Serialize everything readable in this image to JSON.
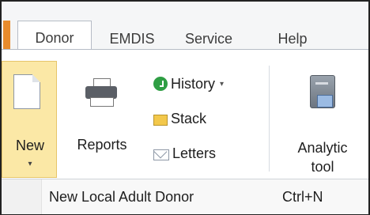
{
  "tabs": [
    {
      "label": "Donor",
      "active": true
    },
    {
      "label": "EMDIS",
      "active": false
    },
    {
      "label": "Service",
      "active": false
    },
    {
      "label": "Help",
      "active": false
    }
  ],
  "ribbon": {
    "new_label": "New",
    "reports_label": "Reports",
    "history_label": "History",
    "stack_label": "Stack",
    "letters_label": "Letters",
    "analytic_line1": "Analytic",
    "analytic_line2": "tool"
  },
  "menu": {
    "item_label": "New Local Adult Donor",
    "item_shortcut": "Ctrl+N"
  },
  "colors": {
    "accent_orange": "#e88b2c",
    "new_button_bg": "#fbe8a6",
    "history_icon": "#2f9e44"
  },
  "icons": {
    "new": "document-icon",
    "reports": "printer-icon",
    "history": "history-icon",
    "stack": "stack-icon",
    "letters": "envelope-icon",
    "analytic": "server-icon"
  }
}
